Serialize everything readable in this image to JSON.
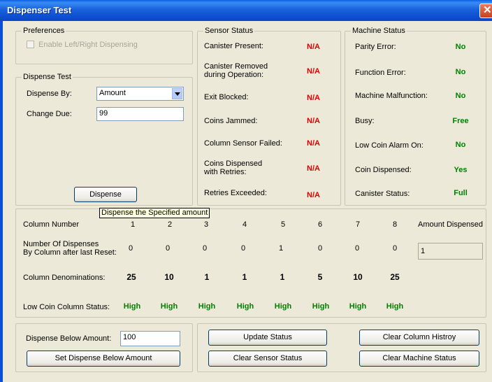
{
  "window": {
    "title": "Dispenser Test"
  },
  "preferences": {
    "legend": "Preferences",
    "enable_lr_label": "Enable Left/Right Dispensing"
  },
  "dispense_test": {
    "legend": "Dispense Test",
    "dispense_by_label": "Dispense By:",
    "dispense_by_value": "Amount",
    "change_due_label": "Change Due:",
    "change_due_value": "99",
    "dispense_button": "Dispense"
  },
  "tooltip": {
    "text": "Dispense the Specified amount"
  },
  "sensor_status": {
    "legend": "Sensor Status",
    "rows": [
      {
        "label": "Canister Present:",
        "value": "N/A"
      },
      {
        "label_line1": "Canister Removed",
        "label_line2": "during Operation:",
        "value": "N/A"
      },
      {
        "label": "Exit Blocked:",
        "value": "N/A"
      },
      {
        "label": "Coins Jammed:",
        "value": "N/A"
      },
      {
        "label": "Column Sensor Failed:",
        "value": "N/A"
      },
      {
        "label_line1": "Coins Dispensed",
        "label_line2": "with Retries:",
        "value": "N/A"
      },
      {
        "label": "Retries Exceeded:",
        "value": "N/A"
      }
    ]
  },
  "machine_status": {
    "legend": "Machine Status",
    "rows": [
      {
        "label": "Parity Error:",
        "value": "No"
      },
      {
        "label": "Function Error:",
        "value": "No"
      },
      {
        "label": "Machine Malfunction:",
        "value": "No"
      },
      {
        "label": "Busy:",
        "value": "Free"
      },
      {
        "label": "Low Coin Alarm On:",
        "value": "No"
      },
      {
        "label": "Coin Dispensed:",
        "value": "Yes"
      },
      {
        "label": "Canister Status:",
        "value": "Full"
      }
    ]
  },
  "columns": {
    "column_number_label": "Column Number",
    "numbers": [
      "1",
      "2",
      "3",
      "4",
      "5",
      "6",
      "7",
      "8"
    ],
    "amount_dispensed_label": "Amount Dispensed",
    "amount_dispensed_value": "1",
    "dispenses_label_line1": "Number Of Dispenses",
    "dispenses_label_line2": "By Column after last Reset:",
    "dispenses": [
      "0",
      "0",
      "0",
      "0",
      "1",
      "0",
      "0",
      "0"
    ],
    "denominations_label": "Column Denominations:",
    "denominations": [
      "25",
      "10",
      "1",
      "1",
      "1",
      "5",
      "10",
      "25"
    ],
    "low_coin_label": "Low Coin Column Status:",
    "low_coin": [
      "High",
      "High",
      "High",
      "High",
      "High",
      "High",
      "High",
      "High"
    ]
  },
  "bottom_left": {
    "dispense_below_label": "Dispense Below Amount:",
    "dispense_below_value": "100",
    "set_button": "Set Dispense Below Amount"
  },
  "bottom_right": {
    "update_status": "Update Status",
    "clear_sensor_status": "Clear Sensor Status",
    "clear_column_history": "Clear Column Histroy",
    "clear_machine_status": "Clear Machine Status"
  },
  "colors": {
    "na": "#e00000",
    "ok": "#008000",
    "titlebar": "#0b4fd0"
  }
}
